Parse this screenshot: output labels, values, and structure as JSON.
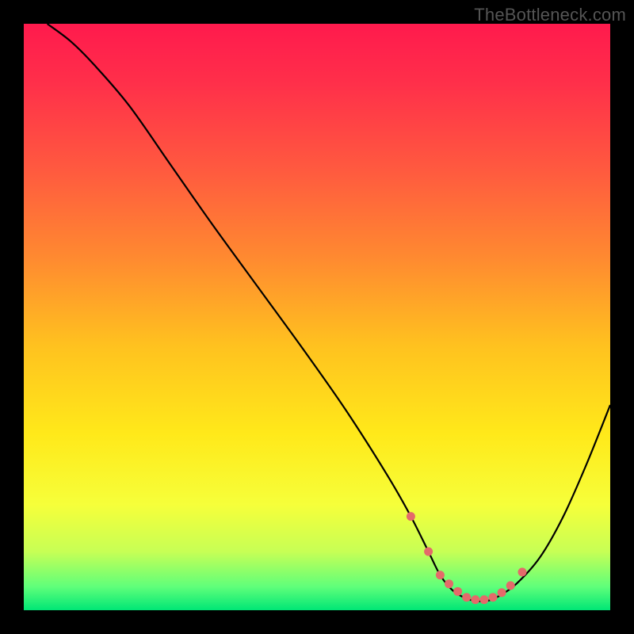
{
  "watermark": "TheBottleneck.com",
  "colors": {
    "background": "#000000",
    "gradient_stops": [
      {
        "offset": 0.0,
        "color": "#ff1a4d"
      },
      {
        "offset": 0.1,
        "color": "#ff2f4a"
      },
      {
        "offset": 0.25,
        "color": "#ff5a3f"
      },
      {
        "offset": 0.4,
        "color": "#ff8a30"
      },
      {
        "offset": 0.55,
        "color": "#ffc21f"
      },
      {
        "offset": 0.7,
        "color": "#ffe91a"
      },
      {
        "offset": 0.82,
        "color": "#f6ff3a"
      },
      {
        "offset": 0.9,
        "color": "#c7ff55"
      },
      {
        "offset": 0.96,
        "color": "#5fff7a"
      },
      {
        "offset": 1.0,
        "color": "#00e676"
      }
    ],
    "curve": "#000000",
    "marker": "#e46a6a"
  },
  "chart_data": {
    "type": "line",
    "title": "",
    "xlabel": "",
    "ylabel": "",
    "xlim": [
      0,
      100
    ],
    "ylim": [
      0,
      100
    ],
    "grid": false,
    "series": [
      {
        "name": "bottleneck-curve",
        "x": [
          4,
          8,
          12,
          18,
          25,
          32,
          40,
          48,
          55,
          62,
          66,
          69,
          71,
          73,
          75,
          77,
          79,
          81,
          84,
          88,
          92,
          96,
          100
        ],
        "y": [
          100,
          97,
          93,
          86,
          76,
          66,
          55,
          44,
          34,
          23,
          16,
          10,
          6,
          3.5,
          2.2,
          1.6,
          1.6,
          2.4,
          4.5,
          9,
          16,
          25,
          35
        ]
      }
    ],
    "markers": {
      "name": "trough-points",
      "x": [
        66,
        69,
        71,
        72.5,
        74,
        75.5,
        77,
        78.5,
        80,
        81.5,
        83,
        85
      ],
      "y": [
        16,
        10,
        6,
        4.5,
        3.2,
        2.2,
        1.8,
        1.8,
        2.2,
        3,
        4.2,
        6.5
      ]
    }
  }
}
